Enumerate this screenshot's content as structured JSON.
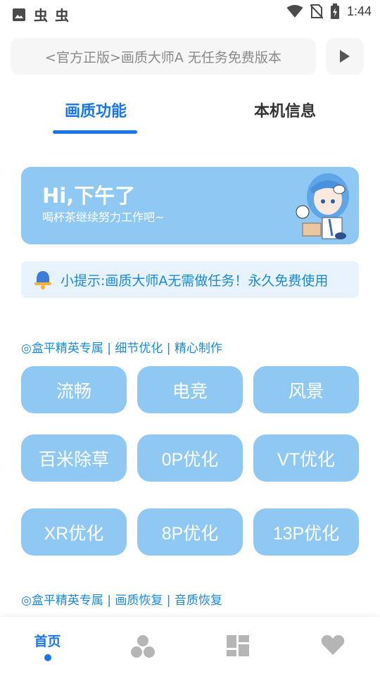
{
  "status_bar": {
    "time": "1:44",
    "app_glyph_1": "虫",
    "app_glyph_2": "虫"
  },
  "notice": {
    "text": "<官方正版>画质大师A 无任务免费版本"
  },
  "tabs": [
    {
      "label": "画质功能",
      "active": true
    },
    {
      "label": "本机信息",
      "active": false
    }
  ],
  "greeting": {
    "title": "Hi,下午了",
    "subtitle": "喝杯茶继续努力工作吧~"
  },
  "tip": {
    "text": "小提示:画质大师A无需做任务！永久免费使用"
  },
  "section1": {
    "title": "◎盒平精英专属 | 细节优化 | 精心制作",
    "buttons": [
      "流畅",
      "电竞",
      "风景",
      "百米除草",
      "0P优化",
      "VT优化",
      "XR优化",
      "8P优化",
      "13P优化"
    ]
  },
  "section2": {
    "title": "◎盒平精英专属 | 画质恢复 | 音质恢复"
  },
  "bottom_nav": {
    "home_label": "首页",
    "icons": [
      "circles-icon",
      "grid-icon",
      "heart-icon"
    ]
  },
  "colors": {
    "accent": "#1876e8",
    "card": "#8fc8f3",
    "tip_bg": "#e7f2fc",
    "tip_text": "#1b8ad6"
  }
}
